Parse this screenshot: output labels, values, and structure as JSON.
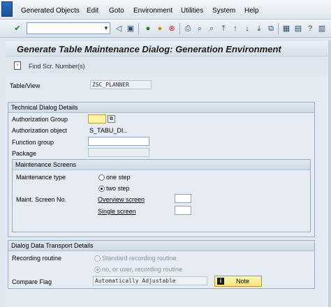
{
  "menu": {
    "items": [
      "Generated Objects",
      "Edit",
      "Goto",
      "Environment",
      "Utilities",
      "System",
      "Help"
    ]
  },
  "toolbar": {
    "command_value": ""
  },
  "screen": {
    "title": "Generate Table Maintenance Dialog: Generation Environment",
    "find_scr_label": "Find Scr. Number(s)"
  },
  "table_view": {
    "label": "Table/View",
    "value": "ZSC_PLANNER"
  },
  "technical": {
    "title": "Technical Dialog Details",
    "auth_group_label": "Authorization Group",
    "auth_group_value": "",
    "auth_object_label": "Authorization object",
    "auth_object_value": "S_TABU_DI..",
    "function_group_label": "Function group",
    "function_group_value": "",
    "package_label": "Package",
    "package_value": ""
  },
  "maintenance": {
    "title": "Maintenance Screens",
    "type_label": "Maintenance type",
    "one_step": "one step",
    "two_step": "two step",
    "screen_no_label": "Maint. Screen No.",
    "overview_label": "Overview screen",
    "overview_value": "",
    "single_label": "Single screen",
    "single_value": ""
  },
  "transport": {
    "title": "Dialog Data Transport Details",
    "recording_label": "Recording routine",
    "standard_routine": "Standard recording routine",
    "no_user_routine": "no, or user, recording routine",
    "compare_label": "Compare Flag",
    "compare_value": "Automatically Adjustable",
    "note_button": "Note"
  }
}
